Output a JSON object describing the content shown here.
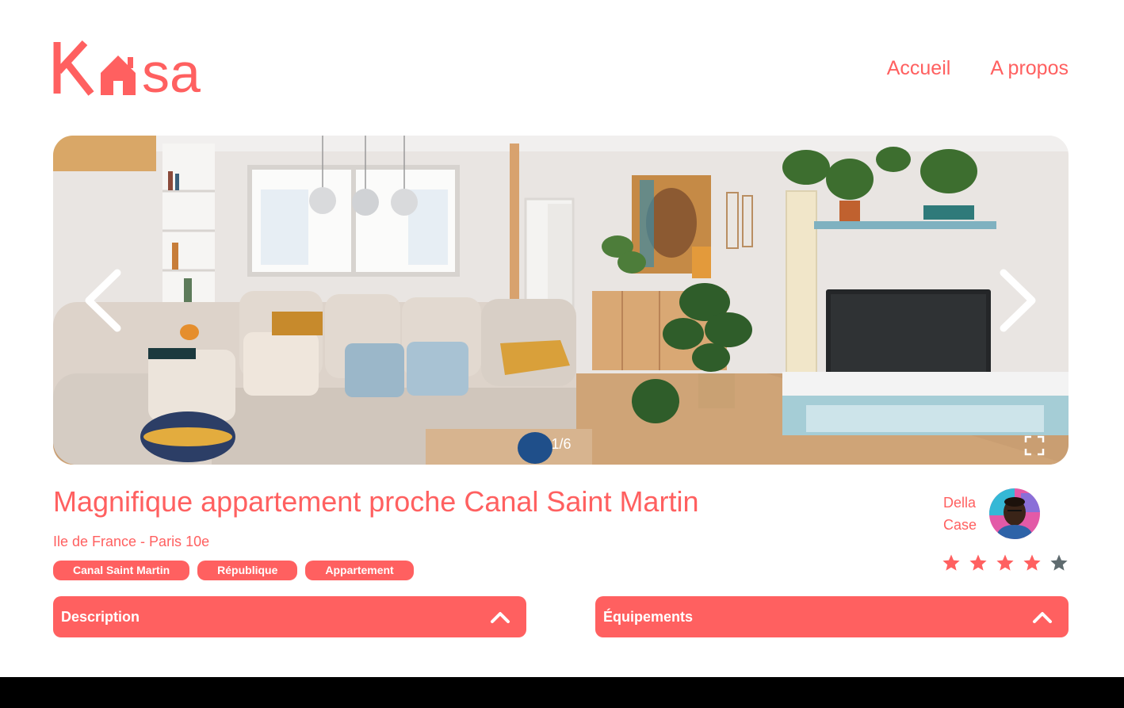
{
  "brand": {
    "logo_text": "Kasa",
    "accent_color": "#FF6060"
  },
  "nav": {
    "home": "Accueil",
    "about": "A propos"
  },
  "gallery": {
    "counter": "1/6",
    "prev_icon": "chevron-left-icon",
    "next_icon": "chevron-right-icon",
    "fullscreen_icon": "expand-icon"
  },
  "listing": {
    "title": "Magnifique appartement proche Canal Saint Martin",
    "location": "Ile de France - Paris 10e",
    "tags": [
      "Canal Saint Martin",
      "République",
      "Appartement"
    ]
  },
  "host": {
    "first_name": "Della",
    "last_name": "Case"
  },
  "rating": {
    "value": 4,
    "max": 5,
    "filled_color": "#FF6060",
    "empty_color": "#5F6B6F"
  },
  "collapses": {
    "description": "Description",
    "equipments": "Équipements"
  }
}
